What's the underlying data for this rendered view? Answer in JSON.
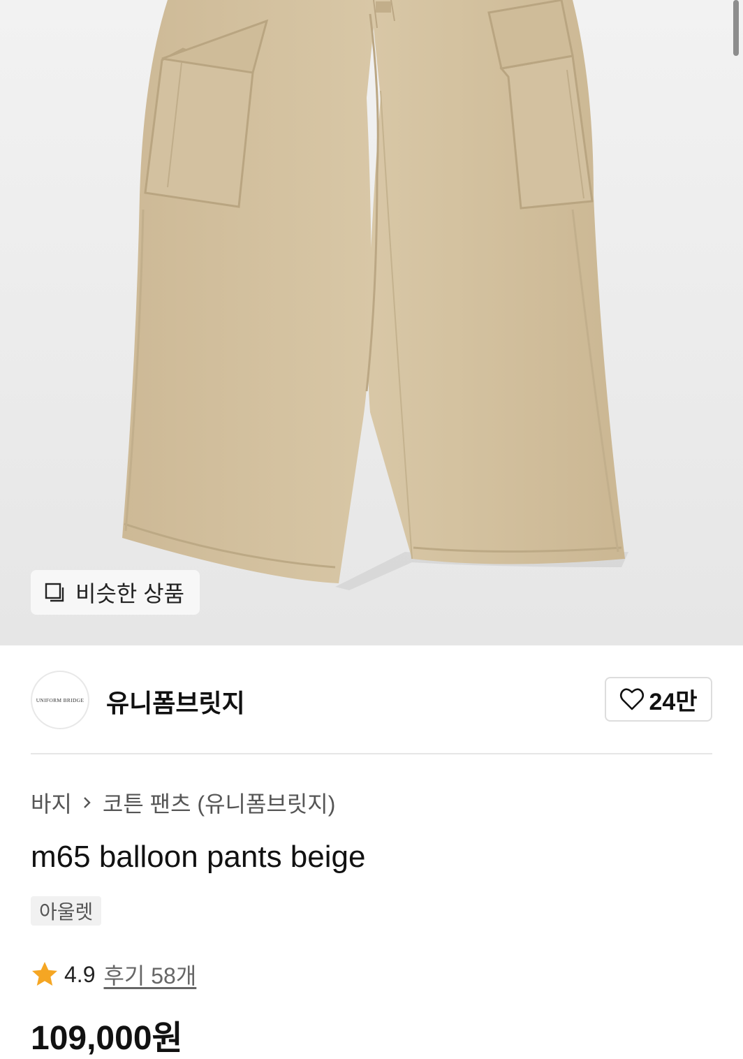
{
  "hero": {
    "similar_products_label": "비슷한 상품"
  },
  "brand": {
    "name": "유니폼브릿지",
    "logo_text": "UNIFORM BRIDGE",
    "like_count": "24만"
  },
  "breadcrumb": {
    "category": "바지",
    "subcategory": "코튼 팬츠 (유니폼브릿지)"
  },
  "product": {
    "title": "m65 balloon pants beige",
    "badge": "아울렛",
    "rating": "4.9",
    "reviews": "후기 58개",
    "price": "109,000원"
  },
  "colors": {
    "fabric": "#d6c4a3",
    "rating_star": "#f5a623"
  }
}
